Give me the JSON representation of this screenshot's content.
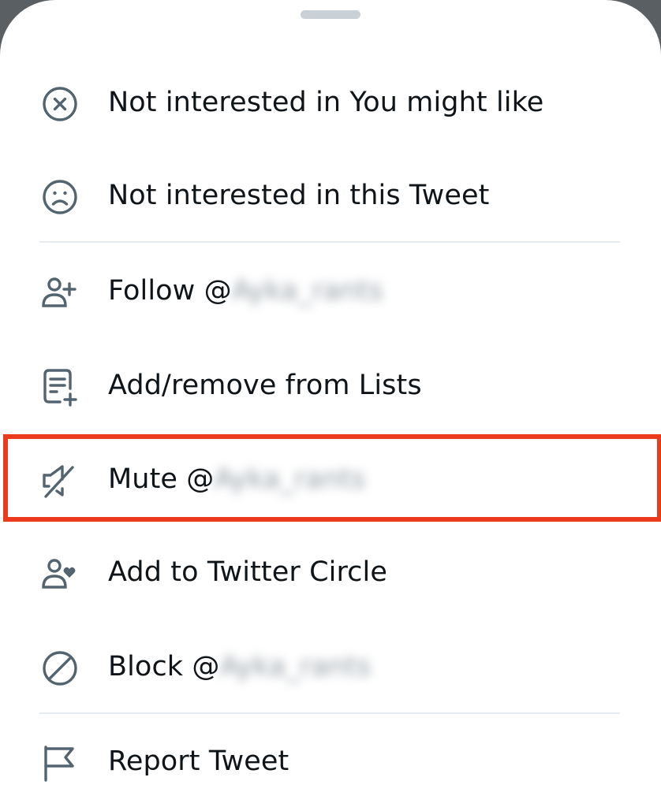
{
  "colors": {
    "text": "#0f1419",
    "icon": "#536471",
    "divider": "#e6ebef",
    "highlight": "#ec3b1c",
    "handle": "#c9d0d6",
    "backdrop": "#5a5f63"
  },
  "menu": {
    "items": [
      {
        "id": "not-interested-you-might-like",
        "icon": "x-circle-icon",
        "label": "Not interested in You might like"
      },
      {
        "id": "not-interested-this-tweet",
        "icon": "sad-face-icon",
        "label": "Not interested in this Tweet"
      },
      {
        "id": "follow",
        "icon": "follow-user-icon",
        "label": "Follow @",
        "handle": "Ayka_rants"
      },
      {
        "id": "add-remove-lists",
        "icon": "list-add-icon",
        "label": "Add/remove from Lists"
      },
      {
        "id": "mute",
        "icon": "mute-speaker-icon",
        "label": "Mute @",
        "handle": "Ayka_rants",
        "highlighted": true
      },
      {
        "id": "add-to-twitter-circle",
        "icon": "user-heart-icon",
        "label": "Add to Twitter Circle"
      },
      {
        "id": "block",
        "icon": "block-icon",
        "label": "Block @",
        "handle": "Ayka_rants"
      },
      {
        "id": "report-tweet",
        "icon": "flag-icon",
        "label": "Report Tweet"
      }
    ]
  }
}
